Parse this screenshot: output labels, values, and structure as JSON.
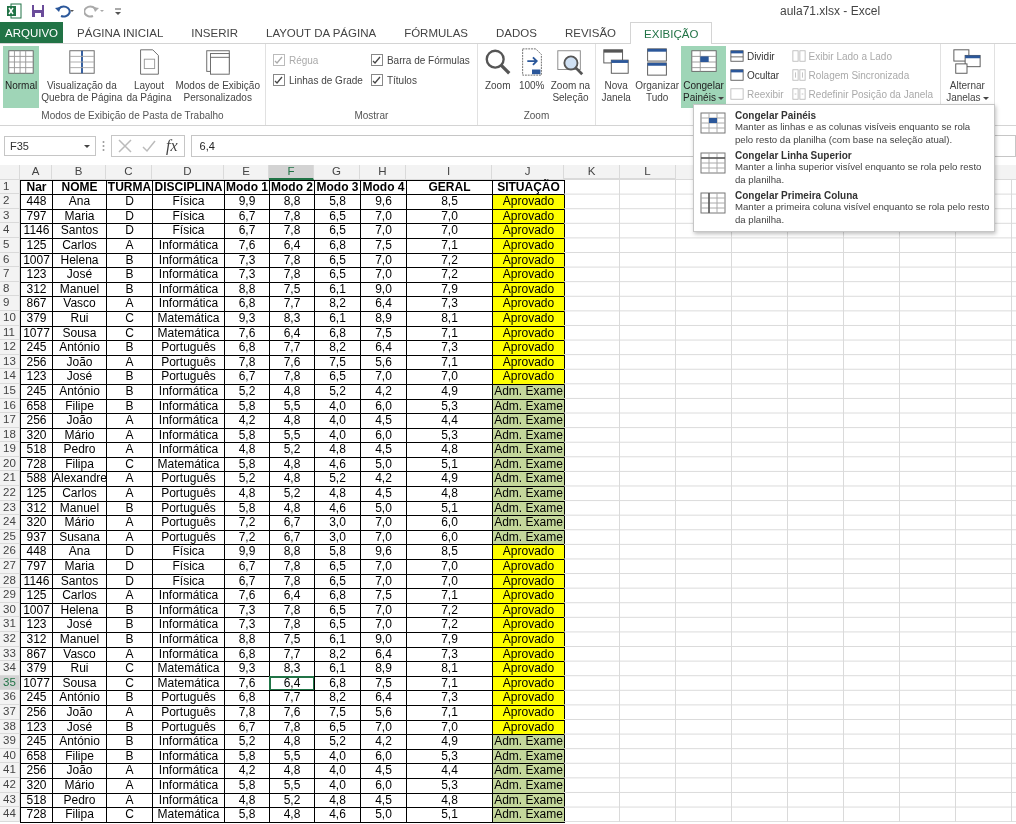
{
  "window": {
    "title": "aula71.xlsx - Excel"
  },
  "tabs": [
    {
      "label": "ARQUIVO",
      "kind": "file",
      "selected": false
    },
    {
      "label": "PÁGINA INICIAL",
      "kind": "tab",
      "selected": false
    },
    {
      "label": "INSERIR",
      "kind": "tab",
      "selected": false
    },
    {
      "label": "LAYOUT DA PÁGINA",
      "kind": "tab",
      "selected": false
    },
    {
      "label": "FÓRMULAS",
      "kind": "tab",
      "selected": false
    },
    {
      "label": "DADOS",
      "kind": "tab",
      "selected": false
    },
    {
      "label": "REVISÃO",
      "kind": "tab",
      "selected": false
    },
    {
      "label": "EXIBIÇÃO",
      "kind": "tab",
      "selected": true
    }
  ],
  "ribbon": {
    "groups": [
      {
        "label": "Modos de Exibição de Pasta de Trabalho",
        "items": [
          {
            "kind": "big",
            "label": "Normal",
            "selected": true
          },
          {
            "kind": "big",
            "label": "Visualização da\nQuebra de Página",
            "selected": false
          },
          {
            "kind": "big",
            "label": "Layout\nda Página",
            "selected": false
          },
          {
            "kind": "big",
            "label": "Modos de Exibição\nPersonalizados",
            "selected": false
          }
        ]
      },
      {
        "label": "Mostrar",
        "items": [
          {
            "kind": "checks",
            "checks": [
              {
                "label": "Régua",
                "checked": true,
                "disabled": true
              },
              {
                "label": "Linhas de Grade",
                "checked": true,
                "disabled": false
              }
            ]
          },
          {
            "kind": "checks",
            "checks": [
              {
                "label": "Barra de Fórmulas",
                "checked": true,
                "disabled": false
              },
              {
                "label": "Títulos",
                "checked": true,
                "disabled": false
              }
            ]
          }
        ]
      },
      {
        "label": "Zoom",
        "items": [
          {
            "kind": "big",
            "label": "Zoom",
            "selected": false
          },
          {
            "kind": "big",
            "label": "100%",
            "selected": false
          },
          {
            "kind": "big",
            "label": "Zoom na\nSeleção",
            "selected": false
          }
        ]
      },
      {
        "items": [
          {
            "kind": "big",
            "label": "Nova\nJanela",
            "selected": false
          },
          {
            "kind": "big",
            "label": "Organizar\nTudo",
            "selected": false
          },
          {
            "kind": "big",
            "label": "Congelar\nPainéis",
            "caret": true,
            "selected": true
          },
          {
            "kind": "smalls",
            "smalls": [
              {
                "label": "Dividir",
                "disabled": false
              },
              {
                "label": "Ocultar",
                "disabled": false
              },
              {
                "label": "Reexibir",
                "disabled": true
              }
            ]
          },
          {
            "kind": "smalls",
            "smalls": [
              {
                "label": "Exibir Lado a Lado",
                "disabled": true
              },
              {
                "label": "Rolagem Sincronizada",
                "disabled": true
              },
              {
                "label": "Redefinir Posição da Janela",
                "disabled": true
              }
            ]
          }
        ]
      },
      {
        "items": [
          {
            "kind": "big",
            "label": "Alternar\nJanelas",
            "caret": true,
            "selected": false
          }
        ]
      }
    ]
  },
  "formula_bar": {
    "name_box": "F35",
    "fx": "fx",
    "value": "6,4"
  },
  "menu": {
    "items": [
      {
        "title": "Congelar Painéis",
        "description": "Manter as linhas e as colunas visíveis enquanto se rola pelo resto da planilha (com base na seleção atual)."
      },
      {
        "title": "Congelar Linha Superior",
        "description": "Manter a linha superior visível enquanto se rola pelo resto da planilha."
      },
      {
        "title": "Congelar Primeira Coluna",
        "description": "Manter a primeira coluna visível enquanto se rola pelo resto da planilha."
      }
    ]
  },
  "sheet": {
    "columns": [
      {
        "label": "A",
        "selected": false
      },
      {
        "label": "B",
        "selected": false
      },
      {
        "label": "C",
        "selected": false
      },
      {
        "label": "D",
        "selected": false
      },
      {
        "label": "E",
        "selected": false
      },
      {
        "label": "F",
        "selected": true
      },
      {
        "label": "G",
        "selected": false
      },
      {
        "label": "H",
        "selected": false
      },
      {
        "label": "I",
        "selected": false
      },
      {
        "label": "J",
        "selected": false
      },
      {
        "label": "K",
        "selected": false
      },
      {
        "label": "L",
        "selected": false
      }
    ],
    "rows": [
      {
        "n": "1",
        "kind": "header",
        "selected": false,
        "cells": [
          "Nar",
          "NOME",
          "TURMA",
          "DISCIPLINA",
          "Modo 1",
          "Modo 2",
          "Modo 3",
          "Modo 4",
          "GERAL",
          "SITUAÇÃO"
        ]
      },
      {
        "n": "2",
        "kind": "approved",
        "selected": false,
        "cells": [
          "448",
          "Ana",
          "D",
          "Física",
          "9,9",
          "8,8",
          "5,8",
          "9,6",
          "8,5",
          "Aprovado"
        ]
      },
      {
        "n": "3",
        "kind": "approved",
        "selected": false,
        "cells": [
          "797",
          "Maria",
          "D",
          "Física",
          "6,7",
          "7,8",
          "6,5",
          "7,0",
          "7,0",
          "Aprovado"
        ]
      },
      {
        "n": "4",
        "kind": "approved",
        "selected": false,
        "cells": [
          "1146",
          "Santos",
          "D",
          "Física",
          "6,7",
          "7,8",
          "6,5",
          "7,0",
          "7,0",
          "Aprovado"
        ]
      },
      {
        "n": "5",
        "kind": "approved",
        "selected": false,
        "cells": [
          "125",
          "Carlos",
          "A",
          "Informática",
          "7,6",
          "6,4",
          "6,8",
          "7,5",
          "7,1",
          "Aprovado"
        ]
      },
      {
        "n": "6",
        "kind": "approved",
        "selected": false,
        "cells": [
          "1007",
          "Helena",
          "B",
          "Informática",
          "7,3",
          "7,8",
          "6,5",
          "7,0",
          "7,2",
          "Aprovado"
        ]
      },
      {
        "n": "7",
        "kind": "approved",
        "selected": false,
        "cells": [
          "123",
          "José",
          "B",
          "Informática",
          "7,3",
          "7,8",
          "6,5",
          "7,0",
          "7,2",
          "Aprovado"
        ]
      },
      {
        "n": "8",
        "kind": "approved",
        "selected": false,
        "cells": [
          "312",
          "Manuel",
          "B",
          "Informática",
          "8,8",
          "7,5",
          "6,1",
          "9,0",
          "7,9",
          "Aprovado"
        ]
      },
      {
        "n": "9",
        "kind": "approved",
        "selected": false,
        "cells": [
          "867",
          "Vasco",
          "A",
          "Informática",
          "6,8",
          "7,7",
          "8,2",
          "6,4",
          "7,3",
          "Aprovado"
        ]
      },
      {
        "n": "10",
        "kind": "approved",
        "selected": false,
        "cells": [
          "379",
          "Rui",
          "C",
          "Matemática",
          "9,3",
          "8,3",
          "6,1",
          "8,9",
          "8,1",
          "Aprovado"
        ]
      },
      {
        "n": "11",
        "kind": "approved",
        "selected": false,
        "cells": [
          "1077",
          "Sousa",
          "C",
          "Matemática",
          "7,6",
          "6,4",
          "6,8",
          "7,5",
          "7,1",
          "Aprovado"
        ]
      },
      {
        "n": "12",
        "kind": "approved",
        "selected": false,
        "cells": [
          "245",
          "António",
          "B",
          "Português",
          "6,8",
          "7,7",
          "8,2",
          "6,4",
          "7,3",
          "Aprovado"
        ]
      },
      {
        "n": "13",
        "kind": "approved",
        "selected": false,
        "cells": [
          "256",
          "João",
          "A",
          "Português",
          "7,8",
          "7,6",
          "7,5",
          "5,6",
          "7,1",
          "Aprovado"
        ]
      },
      {
        "n": "14",
        "kind": "approved",
        "selected": false,
        "cells": [
          "123",
          "José",
          "B",
          "Português",
          "6,7",
          "7,8",
          "6,5",
          "7,0",
          "7,0",
          "Aprovado"
        ]
      },
      {
        "n": "15",
        "kind": "exam",
        "selected": false,
        "cells": [
          "245",
          "António",
          "B",
          "Informática",
          "5,2",
          "4,8",
          "5,2",
          "4,2",
          "4,9",
          "Adm. Exame"
        ]
      },
      {
        "n": "16",
        "kind": "exam",
        "selected": false,
        "cells": [
          "658",
          "Filipe",
          "B",
          "Informática",
          "5,8",
          "5,5",
          "4,0",
          "6,0",
          "5,3",
          "Adm. Exame"
        ]
      },
      {
        "n": "17",
        "kind": "exam",
        "selected": false,
        "cells": [
          "256",
          "João",
          "A",
          "Informática",
          "4,2",
          "4,8",
          "4,0",
          "4,5",
          "4,4",
          "Adm. Exame"
        ]
      },
      {
        "n": "18",
        "kind": "exam",
        "selected": false,
        "cells": [
          "320",
          "Mário",
          "A",
          "Informática",
          "5,8",
          "5,5",
          "4,0",
          "6,0",
          "5,3",
          "Adm. Exame"
        ]
      },
      {
        "n": "19",
        "kind": "exam",
        "selected": false,
        "cells": [
          "518",
          "Pedro",
          "A",
          "Informática",
          "4,8",
          "5,2",
          "4,8",
          "4,5",
          "4,8",
          "Adm. Exame"
        ]
      },
      {
        "n": "20",
        "kind": "exam",
        "selected": false,
        "cells": [
          "728",
          "Filipa",
          "C",
          "Matemática",
          "5,8",
          "4,8",
          "4,6",
          "5,0",
          "5,1",
          "Adm. Exame"
        ]
      },
      {
        "n": "21",
        "kind": "exam",
        "selected": false,
        "cells": [
          "588",
          "Alexandre",
          "A",
          "Português",
          "5,2",
          "4,8",
          "5,2",
          "4,2",
          "4,9",
          "Adm. Exame"
        ]
      },
      {
        "n": "22",
        "kind": "exam",
        "selected": false,
        "cells": [
          "125",
          "Carlos",
          "A",
          "Português",
          "4,8",
          "5,2",
          "4,8",
          "4,5",
          "4,8",
          "Adm. Exame"
        ]
      },
      {
        "n": "23",
        "kind": "exam",
        "selected": false,
        "cells": [
          "312",
          "Manuel",
          "B",
          "Português",
          "5,8",
          "4,8",
          "4,6",
          "5,0",
          "5,1",
          "Adm. Exame"
        ]
      },
      {
        "n": "24",
        "kind": "exam",
        "selected": false,
        "cells": [
          "320",
          "Mário",
          "A",
          "Português",
          "7,2",
          "6,7",
          "3,0",
          "7,0",
          "6,0",
          "Adm. Exame"
        ]
      },
      {
        "n": "25",
        "kind": "exam",
        "selected": false,
        "cells": [
          "937",
          "Susana",
          "A",
          "Português",
          "7,2",
          "6,7",
          "3,0",
          "7,0",
          "6,0",
          "Adm. Exame"
        ]
      },
      {
        "n": "26",
        "kind": "approved",
        "selected": false,
        "cells": [
          "448",
          "Ana",
          "D",
          "Física",
          "9,9",
          "8,8",
          "5,8",
          "9,6",
          "8,5",
          "Aprovado"
        ]
      },
      {
        "n": "27",
        "kind": "approved",
        "selected": false,
        "cells": [
          "797",
          "Maria",
          "D",
          "Física",
          "6,7",
          "7,8",
          "6,5",
          "7,0",
          "7,0",
          "Aprovado"
        ]
      },
      {
        "n": "28",
        "kind": "approved",
        "selected": false,
        "cells": [
          "1146",
          "Santos",
          "D",
          "Física",
          "6,7",
          "7,8",
          "6,5",
          "7,0",
          "7,0",
          "Aprovado"
        ]
      },
      {
        "n": "29",
        "kind": "approved",
        "selected": false,
        "cells": [
          "125",
          "Carlos",
          "A",
          "Informática",
          "7,6",
          "6,4",
          "6,8",
          "7,5",
          "7,1",
          "Aprovado"
        ]
      },
      {
        "n": "30",
        "kind": "approved",
        "selected": false,
        "cells": [
          "1007",
          "Helena",
          "B",
          "Informática",
          "7,3",
          "7,8",
          "6,5",
          "7,0",
          "7,2",
          "Aprovado"
        ]
      },
      {
        "n": "31",
        "kind": "approved",
        "selected": false,
        "cells": [
          "123",
          "José",
          "B",
          "Informática",
          "7,3",
          "7,8",
          "6,5",
          "7,0",
          "7,2",
          "Aprovado"
        ]
      },
      {
        "n": "32",
        "kind": "approved",
        "selected": false,
        "cells": [
          "312",
          "Manuel",
          "B",
          "Informática",
          "8,8",
          "7,5",
          "6,1",
          "9,0",
          "7,9",
          "Aprovado"
        ]
      },
      {
        "n": "33",
        "kind": "approved",
        "selected": false,
        "cells": [
          "867",
          "Vasco",
          "A",
          "Informática",
          "6,8",
          "7,7",
          "8,2",
          "6,4",
          "7,3",
          "Aprovado"
        ]
      },
      {
        "n": "34",
        "kind": "approved",
        "selected": false,
        "cells": [
          "379",
          "Rui",
          "C",
          "Matemática",
          "9,3",
          "8,3",
          "6,1",
          "8,9",
          "8,1",
          "Aprovado"
        ]
      },
      {
        "n": "35",
        "kind": "approved",
        "selected": true,
        "cells": [
          "1077",
          "Sousa",
          "C",
          "Matemática",
          "7,6",
          "6,4",
          "6,8",
          "7,5",
          "7,1",
          "Aprovado"
        ]
      },
      {
        "n": "36",
        "kind": "approved",
        "selected": false,
        "cells": [
          "245",
          "António",
          "B",
          "Português",
          "6,8",
          "7,7",
          "8,2",
          "6,4",
          "7,3",
          "Aprovado"
        ]
      },
      {
        "n": "37",
        "kind": "approved",
        "selected": false,
        "cells": [
          "256",
          "João",
          "A",
          "Português",
          "7,8",
          "7,6",
          "7,5",
          "5,6",
          "7,1",
          "Aprovado"
        ]
      },
      {
        "n": "38",
        "kind": "approved",
        "selected": false,
        "cells": [
          "123",
          "José",
          "B",
          "Português",
          "6,7",
          "7,8",
          "6,5",
          "7,0",
          "7,0",
          "Aprovado"
        ]
      },
      {
        "n": "39",
        "kind": "exam",
        "selected": false,
        "cells": [
          "245",
          "António",
          "B",
          "Informática",
          "5,2",
          "4,8",
          "5,2",
          "4,2",
          "4,9",
          "Adm. Exame"
        ]
      },
      {
        "n": "40",
        "kind": "exam",
        "selected": false,
        "cells": [
          "658",
          "Filipe",
          "B",
          "Informática",
          "5,8",
          "5,5",
          "4,0",
          "6,0",
          "5,3",
          "Adm. Exame"
        ]
      },
      {
        "n": "41",
        "kind": "exam",
        "selected": false,
        "cells": [
          "256",
          "João",
          "A",
          "Informática",
          "4,2",
          "4,8",
          "4,0",
          "4,5",
          "4,4",
          "Adm. Exame"
        ]
      },
      {
        "n": "42",
        "kind": "exam",
        "selected": false,
        "cells": [
          "320",
          "Mário",
          "A",
          "Informática",
          "5,8",
          "5,5",
          "4,0",
          "6,0",
          "5,3",
          "Adm. Exame"
        ]
      },
      {
        "n": "43",
        "kind": "exam",
        "selected": false,
        "cells": [
          "518",
          "Pedro",
          "A",
          "Informática",
          "4,8",
          "5,2",
          "4,8",
          "4,5",
          "4,8",
          "Adm. Exame"
        ]
      },
      {
        "n": "44",
        "kind": "exam",
        "selected": false,
        "cells": [
          "728",
          "Filipa",
          "C",
          "Matemática",
          "5,8",
          "4,8",
          "4,6",
          "5,0",
          "5,1",
          "Adm. Exame"
        ]
      }
    ]
  }
}
